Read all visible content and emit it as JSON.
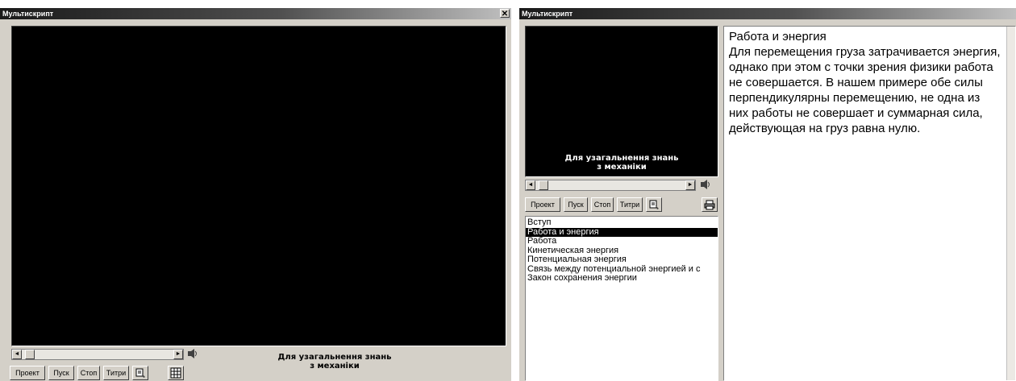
{
  "left_window": {
    "title": "Мультискрипт",
    "close_symbol": "✕",
    "caption": "Для узагальнення знань\nз механіки",
    "toolbar": {
      "project_label": "Проект",
      "start_label": "Пуск",
      "stop_label": "Стоп",
      "titles_label": "Титри"
    }
  },
  "right_window": {
    "title": "Мультискрипт",
    "caption": "Для узагальнення знань\nз механіки",
    "toolbar": {
      "project_label": "Проект",
      "start_label": "Пуск",
      "stop_label": "Стоп",
      "titles_label": "Титри"
    },
    "topics": [
      "Вступ",
      "Работа и энергия",
      "Работа",
      "Кинетическая энергия",
      "Потенциальная энергия",
      "Связь между потенциальной энергией и с",
      "Закон сохранения энергии"
    ],
    "selected_topic_index": 1,
    "article_title": "Работа и энергия",
    "article_body": "Для перемещения груза затрачивается энергия, однако при этом с точки зрения физики работа не совершается. В нашем примере обе силы перпендикулярны перемещению, не одна из них работы не совершает и суммарная сила, действующая на груз равна нулю."
  },
  "icons": {
    "scroll_left": "◄",
    "scroll_right": "►"
  }
}
